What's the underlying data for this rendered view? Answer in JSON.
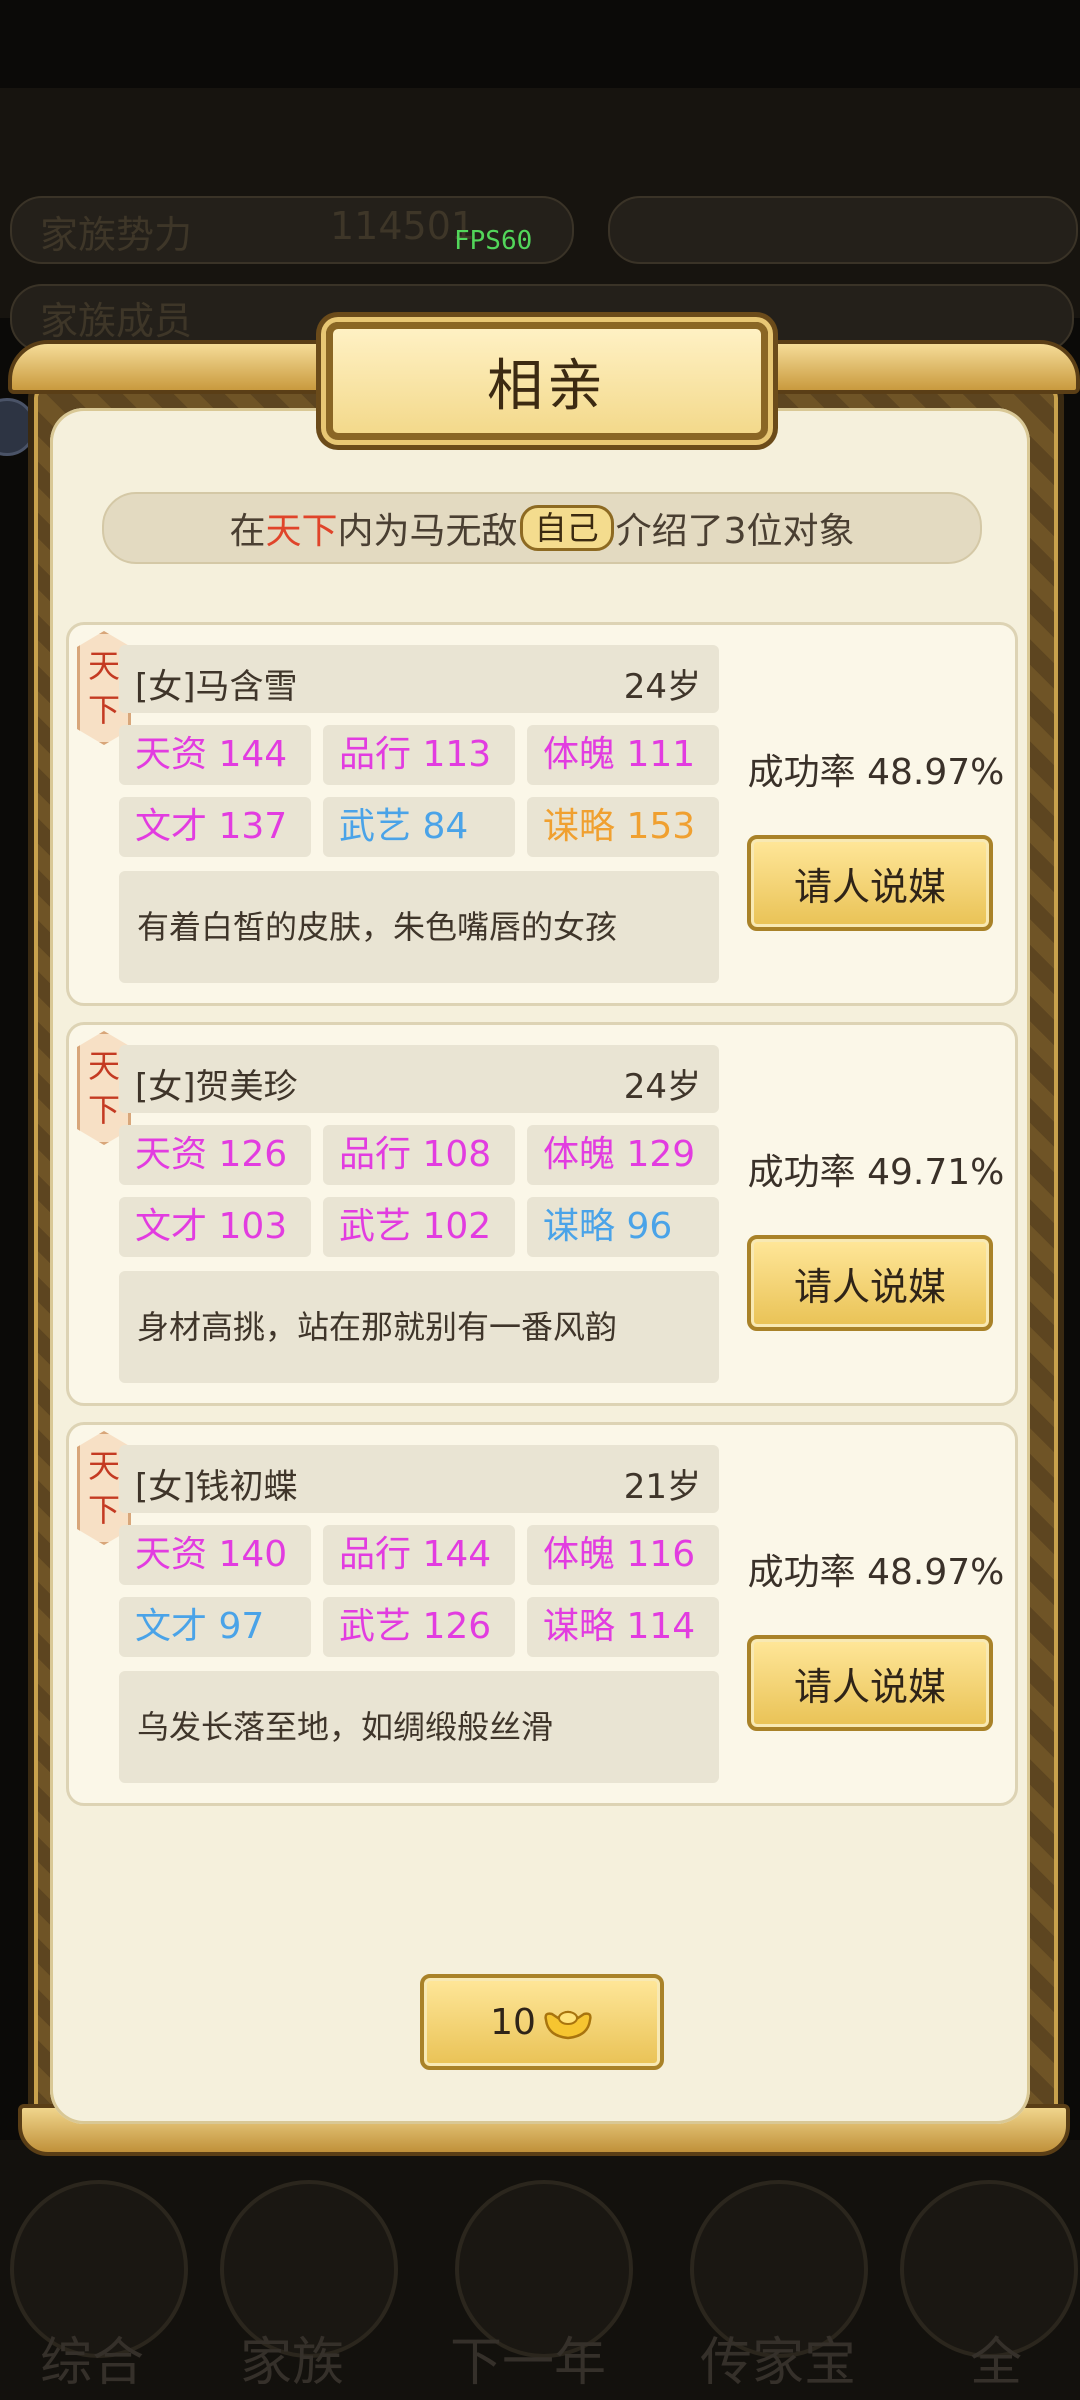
{
  "overlay": {
    "fps": "FPS60",
    "title": "相亲"
  },
  "intro": {
    "prefix": "在",
    "region": "天下",
    "middle": "内为马无敌",
    "self_badge": "自己",
    "suffix": "介绍了3位对象"
  },
  "candidates": [
    {
      "tag_top": "天",
      "tag_bottom": "下",
      "name": "[女]马含雪",
      "age": "24岁",
      "stats": [
        {
          "label": "天资",
          "value": "144",
          "color": "#e23ce0"
        },
        {
          "label": "品行",
          "value": "113",
          "color": "#e23ce0"
        },
        {
          "label": "体魄",
          "value": "111",
          "color": "#e23ce0"
        },
        {
          "label": "文才",
          "value": "137",
          "color": "#e23ce0"
        },
        {
          "label": "武艺",
          "value": "84",
          "color": "#4aa3e8"
        },
        {
          "label": "谋略",
          "value": "153",
          "color": "#f0a030"
        }
      ],
      "description": "有着白皙的皮肤，朱色嘴唇的女孩",
      "success_rate": "成功率 48.97%",
      "button_label": "请人说媒"
    },
    {
      "tag_top": "天",
      "tag_bottom": "下",
      "name": "[女]贺美珍",
      "age": "24岁",
      "stats": [
        {
          "label": "天资",
          "value": "126",
          "color": "#e23ce0"
        },
        {
          "label": "品行",
          "value": "108",
          "color": "#e23ce0"
        },
        {
          "label": "体魄",
          "value": "129",
          "color": "#e23ce0"
        },
        {
          "label": "文才",
          "value": "103",
          "color": "#e23ce0"
        },
        {
          "label": "武艺",
          "value": "102",
          "color": "#e23ce0"
        },
        {
          "label": "谋略",
          "value": "96",
          "color": "#4aa3e8"
        }
      ],
      "description": "身材高挑，站在那就别有一番风韵",
      "success_rate": "成功率 49.71%",
      "button_label": "请人说媒"
    },
    {
      "tag_top": "天",
      "tag_bottom": "下",
      "name": "[女]钱初蝶",
      "age": "21岁",
      "stats": [
        {
          "label": "天资",
          "value": "140",
          "color": "#e23ce0"
        },
        {
          "label": "品行",
          "value": "144",
          "color": "#e23ce0"
        },
        {
          "label": "体魄",
          "value": "116",
          "color": "#e23ce0"
        },
        {
          "label": "文才",
          "value": "97",
          "color": "#4aa3e8"
        },
        {
          "label": "武艺",
          "value": "126",
          "color": "#e23ce0"
        },
        {
          "label": "谋略",
          "value": "114",
          "color": "#e23ce0"
        }
      ],
      "description": "乌发长落至地，如绸缎般丝滑",
      "success_rate": "成功率 48.97%",
      "button_label": "请人说媒"
    }
  ],
  "refresh": {
    "cost": "10",
    "icon": "gold-ingot-icon"
  },
  "background": {
    "labels": [
      "家族势力",
      "114501",
      "家族成员",
      "综合",
      "家族",
      "下一年",
      "传家宝",
      "全"
    ]
  }
}
